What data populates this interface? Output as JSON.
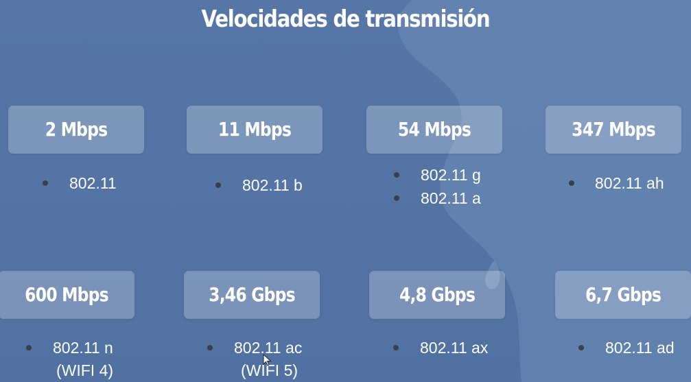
{
  "slide": {
    "title": "Velocidades de transmisión"
  },
  "rates": [
    {
      "speed": "2 Mbps",
      "standards": [
        "802.11"
      ]
    },
    {
      "speed": "11 Mbps",
      "standards": [
        "802.11 b"
      ]
    },
    {
      "speed": "54 Mbps",
      "standards": [
        "802.11 g",
        "802.11 a"
      ]
    },
    {
      "speed": "347 Mbps",
      "standards": [
        "802.11 ah"
      ]
    },
    {
      "speed": "600 Mbps",
      "standards": [
        "802.11 n"
      ],
      "note": "(WIFI 4)"
    },
    {
      "speed": "3,46 Gbps",
      "standards": [
        "802.11 ac"
      ],
      "note": "(WIFI 5)"
    },
    {
      "speed": "4,8 Gbps",
      "standards": [
        "802.11 ax"
      ]
    },
    {
      "speed": "6,7 Gbps",
      "standards": [
        "802.11 ad"
      ]
    }
  ],
  "colors": {
    "background": "#5274a5",
    "card": "rgba(255,255,255,0.24)",
    "text": "#ffffff",
    "bullet": "#3a3f4a"
  }
}
